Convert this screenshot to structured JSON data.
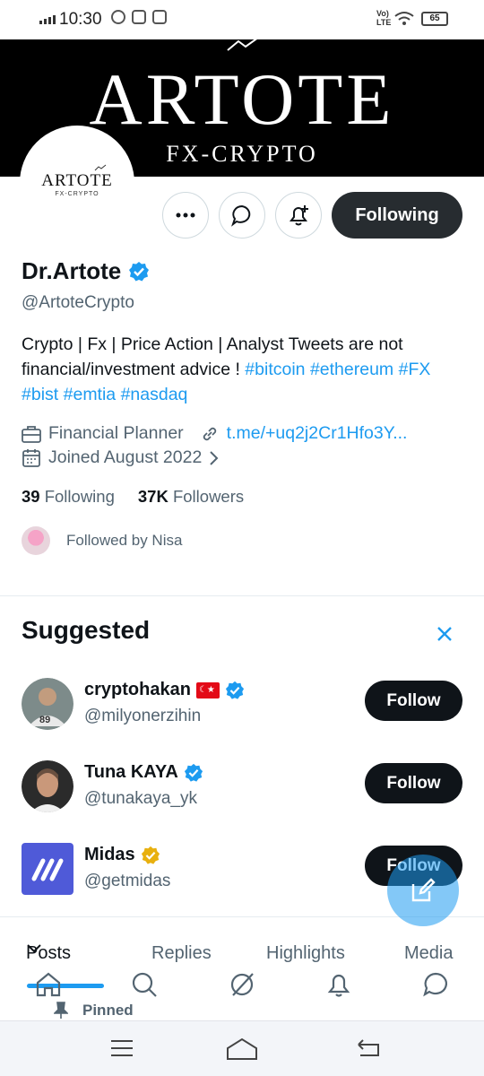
{
  "status_bar": {
    "time": "10:30",
    "battery": "65",
    "network": "VoLTE"
  },
  "banner": {
    "title": "ARTOTE",
    "subtitle": "FX-CRYPTO"
  },
  "avatar": {
    "title": "ARTOTE",
    "subtitle": "FX-CRYPTO"
  },
  "actions": {
    "following_label": "Following"
  },
  "profile": {
    "name": "Dr.Artote",
    "handle": "@ArtoteCrypto",
    "bio_text": "Crypto | Fx | Price Action | Analyst Tweets are not financial/investment advice ! ",
    "hashtags": [
      "#bitcoin",
      "#ethereum",
      "#FX",
      "#bist",
      "#emtia",
      "#nasdaq"
    ],
    "profession": "Financial Planner",
    "link": "t.me/+uq2j2Cr1Hfo3Y...",
    "joined": "Joined August 2022",
    "following_count": "39",
    "following_label": "Following",
    "followers_count": "37K",
    "followers_label": "Followers",
    "followed_by": "Followed by Nisa"
  },
  "suggested": {
    "title": "Suggested",
    "follow_label": "Follow",
    "items": [
      {
        "name": "cryptohakan",
        "handle": "@milyonerzihin"
      },
      {
        "name": "Tuna KAYA",
        "handle": "@tunakaya_yk"
      },
      {
        "name": "Midas",
        "handle": "@getmidas"
      }
    ]
  },
  "tabs": {
    "posts": "Posts",
    "replies": "Replies",
    "highlights": "Highlights",
    "media": "Media"
  },
  "pinned_label": "Pinned",
  "colors": {
    "accent": "#1d9bf0",
    "text": "#0f1419",
    "muted": "#536471",
    "gold": "#e8b00f"
  }
}
